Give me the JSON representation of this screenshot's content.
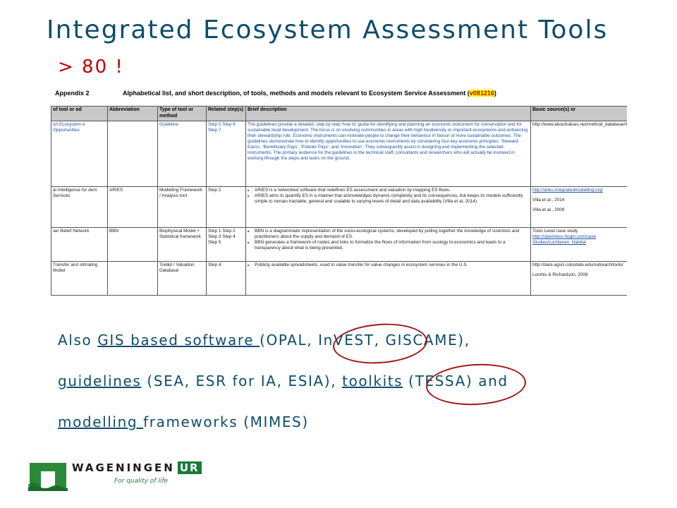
{
  "slide": {
    "title": "Integrated Ecosystem Assessment Tools",
    "subtitle": "> 80 !"
  },
  "appendix": {
    "label": "Appendix 2",
    "caption": "Alphabetical list, and short description, of tools, methods and models relevant to Ecosystem Service Assessment (",
    "version": "v081216",
    "close": ")"
  },
  "table": {
    "headers": [
      "of tool or od",
      "Abbreviation",
      "Type of tool or method",
      "Related step(s)",
      "Brief description",
      "Basic source(s) or"
    ],
    "rows": [
      {
        "name": "on Ecosystem e Opportunities",
        "abbr": "",
        "type": "Guideline",
        "steps": "Step 0 Step 6 Step 7",
        "desc": "The guidelines provide a detailed, step by step 'how to' guide for identifying and planning an economic instrument for conservation and for sustainable local development. The focus is on involving communities in areas with high biodiversity or important ecosystems and enhancing their stewardship role. Economic instruments can motivate people to change their behaviour in favour of more sustainable outcomes. The guidelines demonstrate how to identify opportunities to use economic instruments by considering four key economic principles: 'Steward Earns', 'Beneficiary Pays', 'Polluter Pays', and 'Innovation'. They subsequently assist in designing and implementing the selected instruments. The primary audience for the guidelines is the technical staff, consultants and researchers who will actually be involved in working through the steps and tasks on the ground.",
        "source": "http://www.aboutvalues.net/method_database/#"
      },
      {
        "name": "al Intelligence for dem Services",
        "abbr": "ARIES",
        "type": "Modelling Framework / Analysis tool",
        "steps": "Step 2",
        "bullets": [
          "ARIES is a networked software that redefines ES assessment and valuation by mapping ES flows.",
          "ARIES aims to quantify ES in a manner that acknowledges dynamic complexity and its consequences, but keeps its models sufficiently simple to remain tractable, general and scalable to varying levels of detail and data availability (Villa et al, 2014)."
        ],
        "source": "http://aries.integratedmodelling.org/",
        "source2": "Villa et al., 2014",
        "source3": "Villa et al., 2009"
      },
      {
        "name": "ian Belief Network",
        "abbr": "BBN",
        "type": "Biophysical Model + Statistical framework",
        "steps": "Step 1 Step 2 Step 3 Step 4 Step 5",
        "bullets": [
          "BBN is a diagrammatic representation of the socio-ecological systems, developed by pulling together the knowledge of scientists and practitioners about the supply and demand of ES.",
          "BBN generates a framework of nodes and links to formalize the flows of information from ecology to economics and leads to a transparency about what is being presented."
        ],
        "source": "Tools Level case study",
        "source2": "http://openness.hugin.com/case",
        "source3": "Studies/Lochleven_Habitat"
      },
      {
        "name": "Transfer and stimating Model",
        "abbr": "",
        "type": "Toolkit / Valuation Database",
        "steps": "Step 4",
        "bullets": [
          "Publicly available spreadsheets, used to value transfer for value changes in ecosystem services in the U.S."
        ],
        "source": "http://dare.agsci.colostate.edu/outreach/tools/",
        "source2": "Loomis & Richardson, 2008"
      }
    ]
  },
  "body": {
    "line1_prefix": "Also ",
    "line1_link": "GIS based software ",
    "line1_suffix": "(OPAL, InVEST, GISCAME),",
    "line2_link1": "guidelines",
    "line2_mid": " (SEA, ESR for IA, ESIA), ",
    "line2_link2": "toolkits",
    "line2_suffix": " (TESSA) and",
    "line3_link": "modelling ",
    "line3_suffix": "frameworks (MIMES)"
  },
  "logo": {
    "name": "WAGENINGEN",
    "ur": "UR",
    "tagline": "For quality of life"
  },
  "colors": {
    "title": "#0d4d6b",
    "subtitle": "#c00000",
    "highlight_ellipse": "#a01818",
    "brand_green": "#1a7a3a"
  }
}
